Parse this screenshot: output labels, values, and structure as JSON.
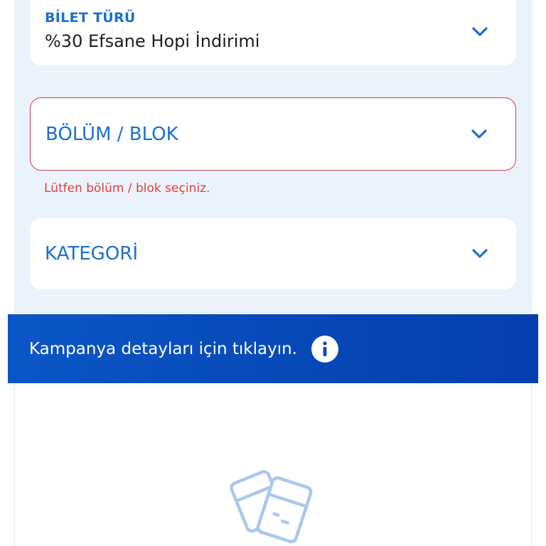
{
  "ticket_type": {
    "label": "BİLET TÜRÜ",
    "value": "%30 Efsane Hopi İndirimi",
    "icon": "chevron-down-icon"
  },
  "section_block": {
    "label": "BÖLÜM / BLOK",
    "error": "Lütfen bölüm / blok seçiniz.",
    "icon": "chevron-down-icon"
  },
  "category": {
    "label": "KATEGORİ",
    "icon": "chevron-down-icon"
  },
  "promo_banner": {
    "text": "Kampanya detayları için tıklayın.",
    "icon": "info-icon"
  },
  "colors": {
    "accent_blue": "#1a6fd1",
    "error_red": "#e2403a",
    "error_border": "#d23a57",
    "banner_blue": "#0747b6",
    "panel_bg": "#eaf2fb"
  }
}
